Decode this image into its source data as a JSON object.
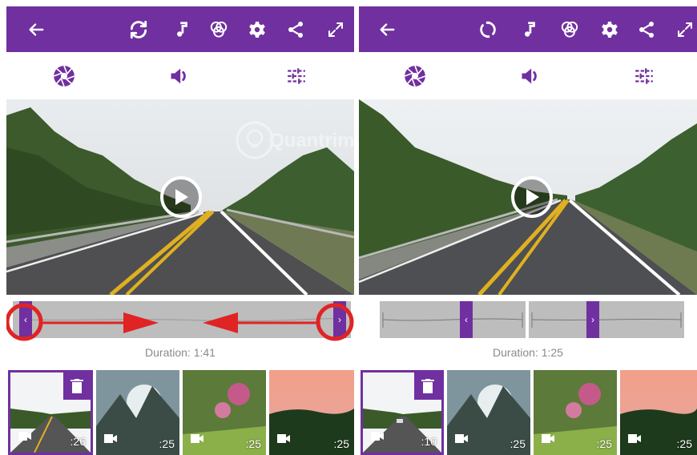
{
  "panels": [
    {
      "duration": "Duration: 1:41",
      "clips": [
        ":26",
        ":25",
        ":25",
        ":25"
      ]
    },
    {
      "duration": "Duration: 1:25",
      "clips": [
        ":10",
        ":25",
        ":25",
        ":25"
      ]
    }
  ],
  "toolbar_icons": [
    "back-arrow-icon",
    "refresh-icon",
    "music-note-icon",
    "filters-icon",
    "gear-icon",
    "share-icon",
    "expand-icon"
  ],
  "subbar_icons": [
    "aperture-icon",
    "volume-icon",
    "sliders-icon"
  ],
  "handles": {
    "left": "‹",
    "right": "›"
  },
  "watermark": "Quantrimang",
  "colors": {
    "accent": "#7030a0",
    "annotation": "#e02424"
  }
}
